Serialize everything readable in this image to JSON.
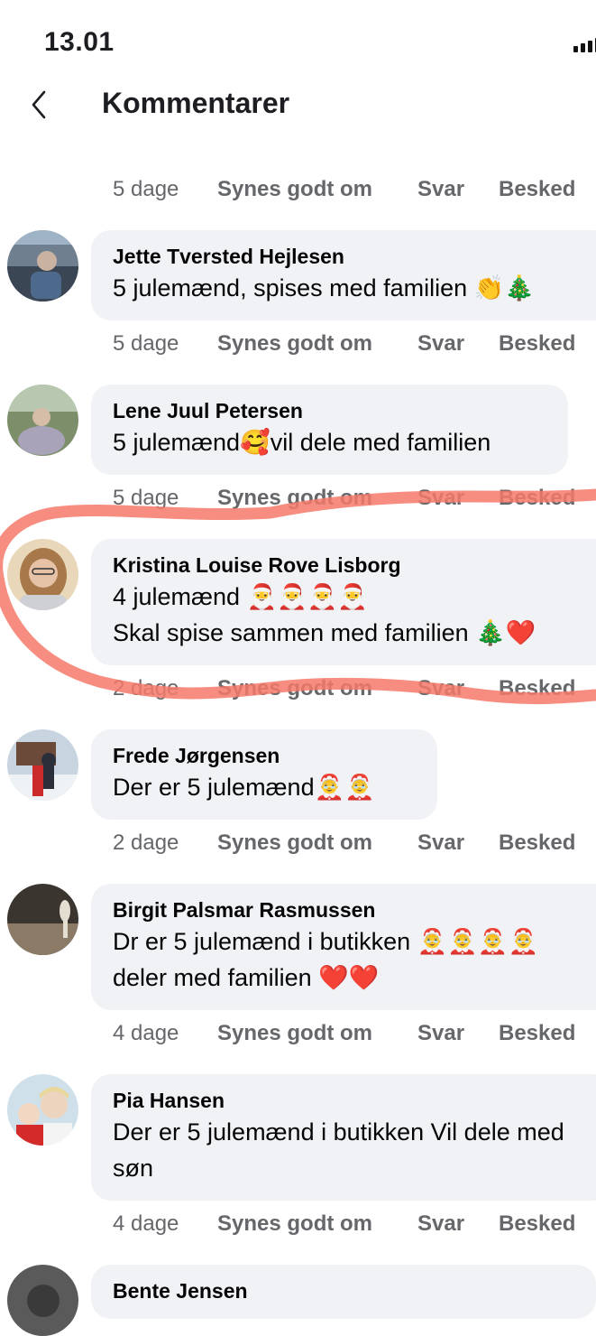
{
  "status_bar": {
    "time": "13.01"
  },
  "header": {
    "title": "Kommentarer",
    "back_icon": "chevron-left-icon"
  },
  "actions": {
    "like": "Synes godt om",
    "reply": "Svar",
    "message": "Besked"
  },
  "top_meta": {
    "time": "5 dage"
  },
  "comments": [
    {
      "author": "Jette Tversted Hejlesen",
      "lines": [
        "5 julemænd, spises med familien 👏🎄"
      ],
      "time": "5 dage"
    },
    {
      "author": "Lene Juul Petersen",
      "lines": [
        "5 julemænd🥰vil dele med familien"
      ],
      "time": "5 dage"
    },
    {
      "author": "Kristina Louise Rove Lisborg",
      "lines": [
        "4 julemænd 🎅🎅🎅🎅",
        "Skal spise sammen med familien 🎄❤️"
      ],
      "time": "2 dage"
    },
    {
      "author": "Frede Jørgensen",
      "lines": [
        "Der er 5 julemænd🤶🤶"
      ],
      "time": "2 dage"
    },
    {
      "author": "Birgit Palsmar Rasmussen",
      "lines": [
        "Dr er 5 julemænd i butikken 🤶🤶🤶🤶",
        "deler med familien ❤️❤️"
      ],
      "time": "4 dage"
    },
    {
      "author": "Pia Hansen",
      "lines": [
        "Der er 5 julemænd i butikken Vil dele med",
        "søn"
      ],
      "time": "4 dage"
    },
    {
      "author": "Bente Jensen",
      "lines": [],
      "time": ""
    }
  ],
  "colors": {
    "highlight": "#f4796a",
    "bubble": "#f0f2f5",
    "meta": "#65676b"
  }
}
